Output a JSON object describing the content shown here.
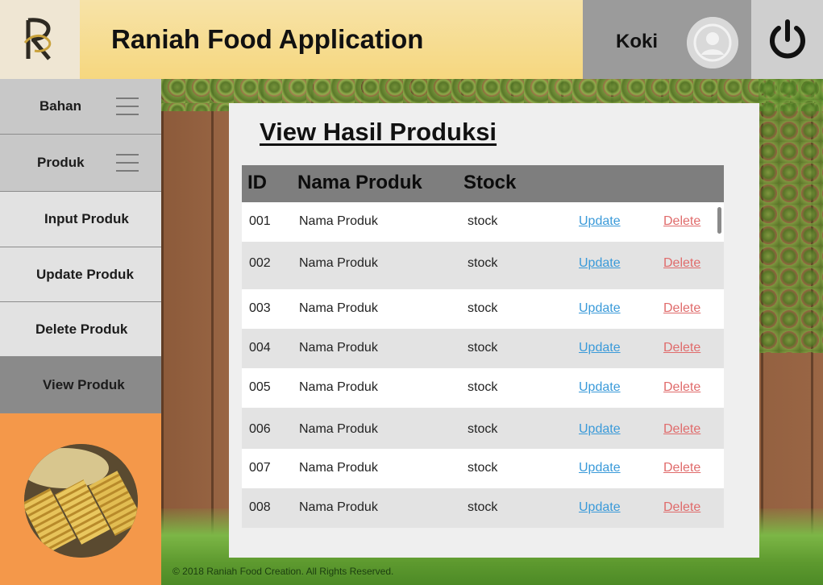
{
  "header": {
    "app_title": "Raniah Food Application",
    "user_name": "Koki"
  },
  "sidebar": {
    "items": [
      {
        "label": "Bahan",
        "type": "main"
      },
      {
        "label": "Produk",
        "type": "main"
      },
      {
        "label": "Input Produk",
        "type": "sub"
      },
      {
        "label": "Update Produk",
        "type": "sub"
      },
      {
        "label": "Delete Produk",
        "type": "sub"
      },
      {
        "label": "View Produk",
        "type": "active"
      }
    ]
  },
  "main": {
    "title": "View Hasil Produksi",
    "table": {
      "headers": [
        "ID",
        "Nama Produk",
        "Stock"
      ],
      "rows": [
        {
          "id": "001",
          "name": "Nama Produk",
          "stock": "stock",
          "update": "Update",
          "delete": "Delete"
        },
        {
          "id": "002",
          "name": "Nama Produk",
          "stock": "stock",
          "update": "Update",
          "delete": "Delete"
        },
        {
          "id": "003",
          "name": "Nama Produk",
          "stock": "stock",
          "update": "Update",
          "delete": "Delete"
        },
        {
          "id": "004",
          "name": "Nama Produk",
          "stock": "stock",
          "update": "Update",
          "delete": "Delete"
        },
        {
          "id": "005",
          "name": "Nama Produk",
          "stock": "stock",
          "update": "Update",
          "delete": "Delete"
        },
        {
          "id": "006",
          "name": "Nama Produk",
          "stock": "stock",
          "update": "Update",
          "delete": "Delete"
        },
        {
          "id": "007",
          "name": "Nama Produk",
          "stock": "stock",
          "update": "Update",
          "delete": "Delete"
        },
        {
          "id": "008",
          "name": "Nama Produk",
          "stock": "stock",
          "update": "Update",
          "delete": "Delete"
        }
      ]
    }
  },
  "footer": {
    "text": "© 2018 Raniah Food Creation. All Rights Reserved."
  },
  "icons": {
    "logo": "raniah-logo",
    "avatar": "user-avatar-icon",
    "power": "power-icon",
    "menu": "hamburger-icon"
  },
  "colors": {
    "title_bar": "#f6d77f",
    "food_panel": "#f4984a",
    "update_link": "#3a9ad9",
    "delete_link": "#e06b6b",
    "table_header": "#7e7e7e"
  }
}
